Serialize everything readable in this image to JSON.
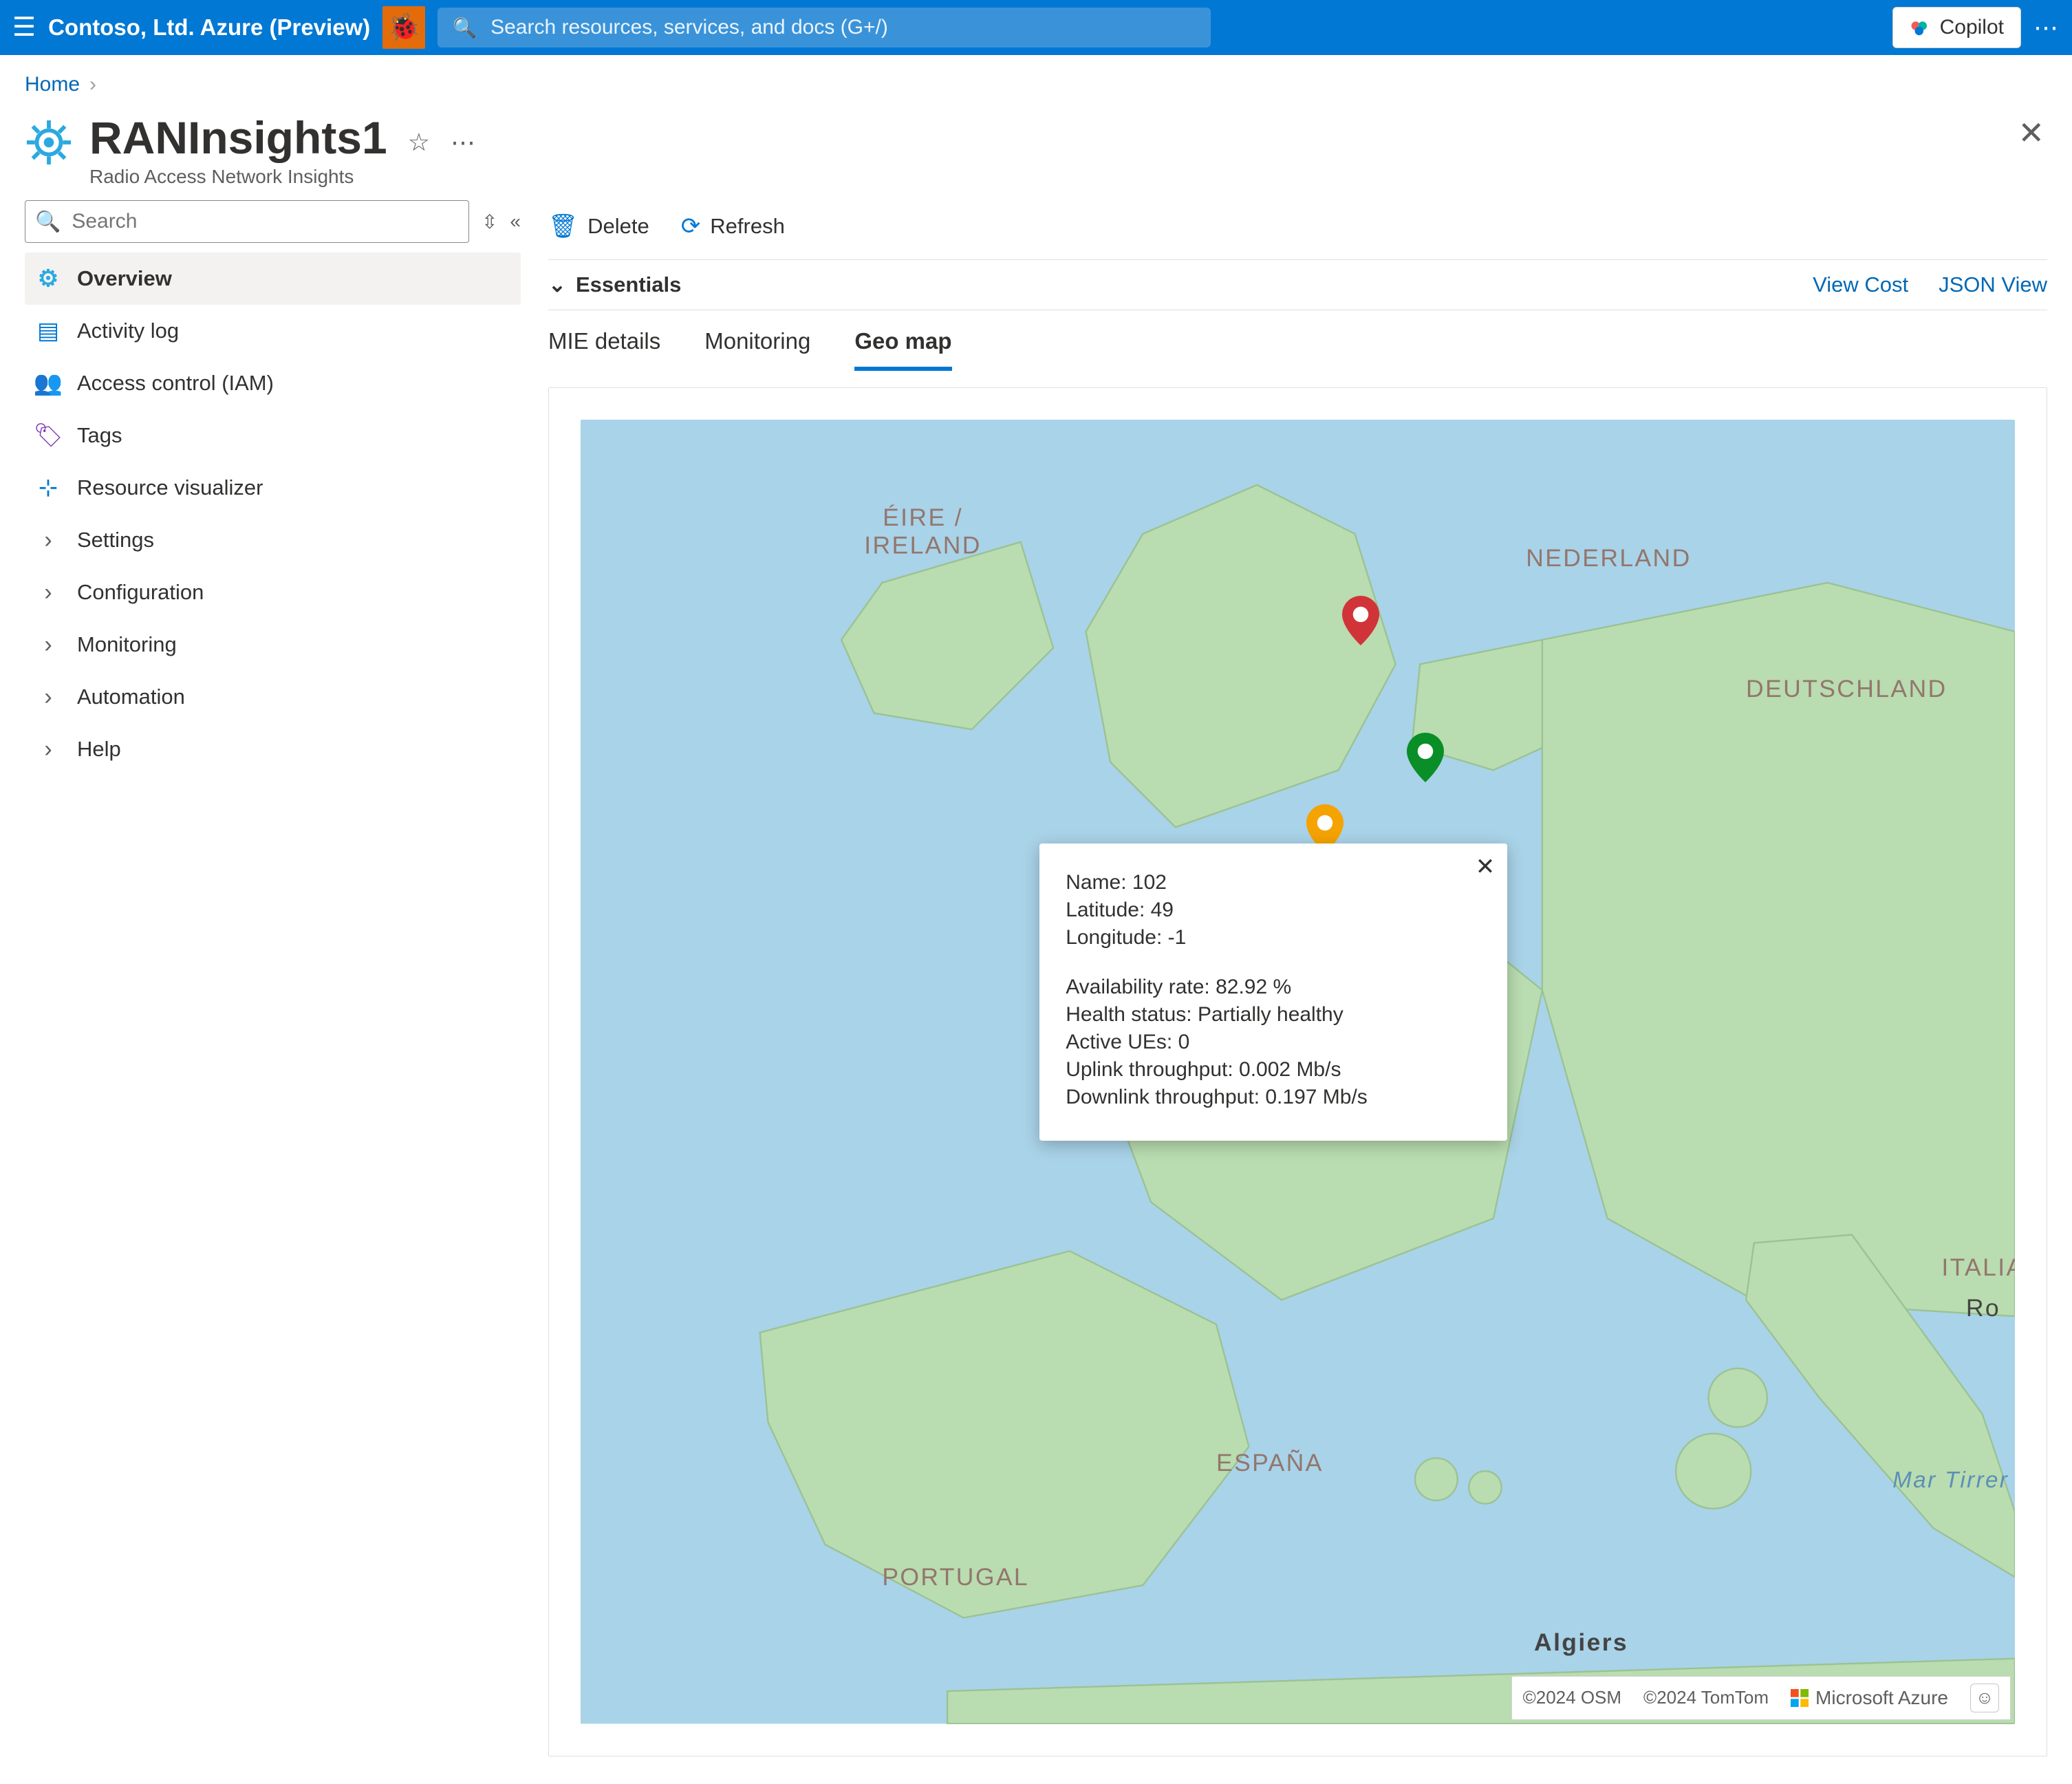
{
  "topbar": {
    "tenant": "Contoso, Ltd. Azure (Preview)",
    "search_placeholder": "Search resources, services, and docs (G+/)",
    "copilot_label": "Copilot"
  },
  "breadcrumb": {
    "home": "Home"
  },
  "header": {
    "title": "RANInsights1",
    "subtitle": "Radio Access Network Insights"
  },
  "sidebar": {
    "search_placeholder": "Search",
    "items": [
      {
        "label": "Overview",
        "icon": "gear-icon",
        "icon_glyph": "⚙",
        "active": true,
        "chev": false,
        "icon_color": "#2aa9e0"
      },
      {
        "label": "Activity log",
        "icon": "log-icon",
        "icon_glyph": "▤",
        "active": false,
        "chev": false,
        "icon_color": "#0078d4"
      },
      {
        "label": "Access control (IAM)",
        "icon": "people-icon",
        "icon_glyph": "👥",
        "active": false,
        "chev": false,
        "icon_color": "#0078d4"
      },
      {
        "label": "Tags",
        "icon": "tag-icon",
        "icon_glyph": "🏷",
        "active": false,
        "chev": false,
        "icon_color": "#7b2fb5"
      },
      {
        "label": "Resource visualizer",
        "icon": "visualizer-icon",
        "icon_glyph": "⊹",
        "active": false,
        "chev": false,
        "icon_color": "#0078d4"
      },
      {
        "label": "Settings",
        "icon": "chevron-right-icon",
        "icon_glyph": "›",
        "active": false,
        "chev": true,
        "icon_color": "#605e5c"
      },
      {
        "label": "Configuration",
        "icon": "chevron-right-icon",
        "icon_glyph": "›",
        "active": false,
        "chev": true,
        "icon_color": "#605e5c"
      },
      {
        "label": "Monitoring",
        "icon": "chevron-right-icon",
        "icon_glyph": "›",
        "active": false,
        "chev": true,
        "icon_color": "#605e5c"
      },
      {
        "label": "Automation",
        "icon": "chevron-right-icon",
        "icon_glyph": "›",
        "active": false,
        "chev": true,
        "icon_color": "#605e5c"
      },
      {
        "label": "Help",
        "icon": "chevron-right-icon",
        "icon_glyph": "›",
        "active": false,
        "chev": true,
        "icon_color": "#605e5c"
      }
    ]
  },
  "toolbar": {
    "delete_label": "Delete",
    "refresh_label": "Refresh"
  },
  "essentials": {
    "label": "Essentials",
    "view_cost": "View Cost",
    "json_view": "JSON View"
  },
  "tabs": [
    {
      "label": "MIE details",
      "active": false
    },
    {
      "label": "Monitoring",
      "active": false
    },
    {
      "label": "Geo map",
      "active": true
    }
  ],
  "map": {
    "attrib_osm": "©2024 OSM",
    "attrib_tomtom": "©2024 TomTom",
    "attrib_azure": "Microsoft Azure",
    "labels": {
      "ireland": "ÉIRE /\nIRELAND",
      "nederland": "NEDERLAND",
      "deutschland": "DEUTSCHLAND",
      "italia": "ITALIA",
      "ro": "Ro",
      "espana": "ESPAÑA",
      "portugal": "PORTUGAL",
      "algiers": "Algiers",
      "martirren": "Mar Tirrer"
    }
  },
  "popup": {
    "name_label": "Name:",
    "name_value": "102",
    "lat_label": "Latitude:",
    "lat_value": "49",
    "long_label": "Longitude:",
    "long_value": "-1",
    "avail_label": "Availability rate:",
    "avail_value": "82.92 %",
    "health_label": "Health status:",
    "health_value": "Partially healthy",
    "ues_label": "Active UEs:",
    "ues_value": "0",
    "ul_label": "Uplink throughput:",
    "ul_value": "0.002 Mb/s",
    "dl_label": "Downlink throughput:",
    "dl_value": "0.197 Mb/s"
  }
}
